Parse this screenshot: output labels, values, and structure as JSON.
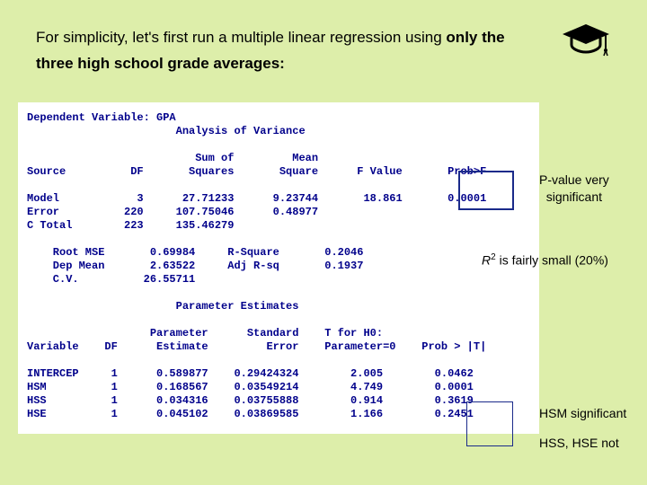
{
  "intro_html": "For simplicity, let's first run a multiple linear regression using <b>only the three high school grade averages:</b>",
  "gradcap_alt": "graduation-cap-icon",
  "sas_output": "Dependent Variable: GPA\n                       Analysis of Variance\n\n                          Sum of         Mean\nSource          DF       Squares       Square      F Value       Prob>F\n\nModel            3      27.71233      9.23744       18.861       0.0001\nError          220     107.75046      0.48977\nC Total        223     135.46279\n\n    Root MSE       0.69984     R-Square       0.2046\n    Dep Mean       2.63522     Adj R-sq       0.1937\n    C.V.          26.55711\n\n                       Parameter Estimates\n\n                   Parameter      Standard    T for H0:\nVariable    DF      Estimate         Error    Parameter=0    Prob > |T|\n\nINTERCEP     1      0.589877    0.29424324        2.005        0.0462\nHSM          1      0.168567    0.03549214        4.749        0.0001\nHSS          1      0.034316    0.03755888        0.914        0.3619\nHSE          1      0.045102    0.03869585        1.166        0.2451",
  "label_pvalue_line1": "P-value very",
  "label_pvalue_line2": "significant",
  "label_r2_html": "<i>R</i><sup>2</sup> is fairly small (20%)",
  "label_hsm": "HSM significant",
  "label_hss_hse": "HSS, HSE not",
  "chart_data": {
    "type": "table",
    "title": "Multiple linear regression — GPA on HSM, HSS, HSE",
    "dependent_variable": "GPA",
    "anova": {
      "columns": [
        "Source",
        "DF",
        "Sum of Squares",
        "Mean Square",
        "F Value",
        "Prob>F"
      ],
      "rows": [
        [
          "Model",
          3,
          27.71233,
          9.23744,
          18.861,
          0.0001
        ],
        [
          "Error",
          220,
          107.75046,
          0.48977,
          null,
          null
        ],
        [
          "C Total",
          223,
          135.46279,
          null,
          null,
          null
        ]
      ]
    },
    "fit": {
      "Root MSE": 0.69984,
      "Dep Mean": 2.63522,
      "C.V.": 26.55711,
      "R-Square": 0.2046,
      "Adj R-sq": 0.1937
    },
    "parameter_estimates": {
      "columns": [
        "Variable",
        "DF",
        "Parameter Estimate",
        "Standard Error",
        "T for H0: Parameter=0",
        "Prob > |T|"
      ],
      "rows": [
        [
          "INTERCEP",
          1,
          0.589877,
          0.29424324,
          2.005,
          0.0462
        ],
        [
          "HSM",
          1,
          0.168567,
          0.03549214,
          4.749,
          0.0001
        ],
        [
          "HSS",
          1,
          0.034316,
          0.03755888,
          0.914,
          0.3619
        ],
        [
          "HSE",
          1,
          0.045102,
          0.03869585,
          1.166,
          0.2451
        ]
      ]
    },
    "annotations": [
      "P-value very significant",
      "R^2 is fairly small (20%)",
      "HSM significant",
      "HSS, HSE not"
    ]
  }
}
